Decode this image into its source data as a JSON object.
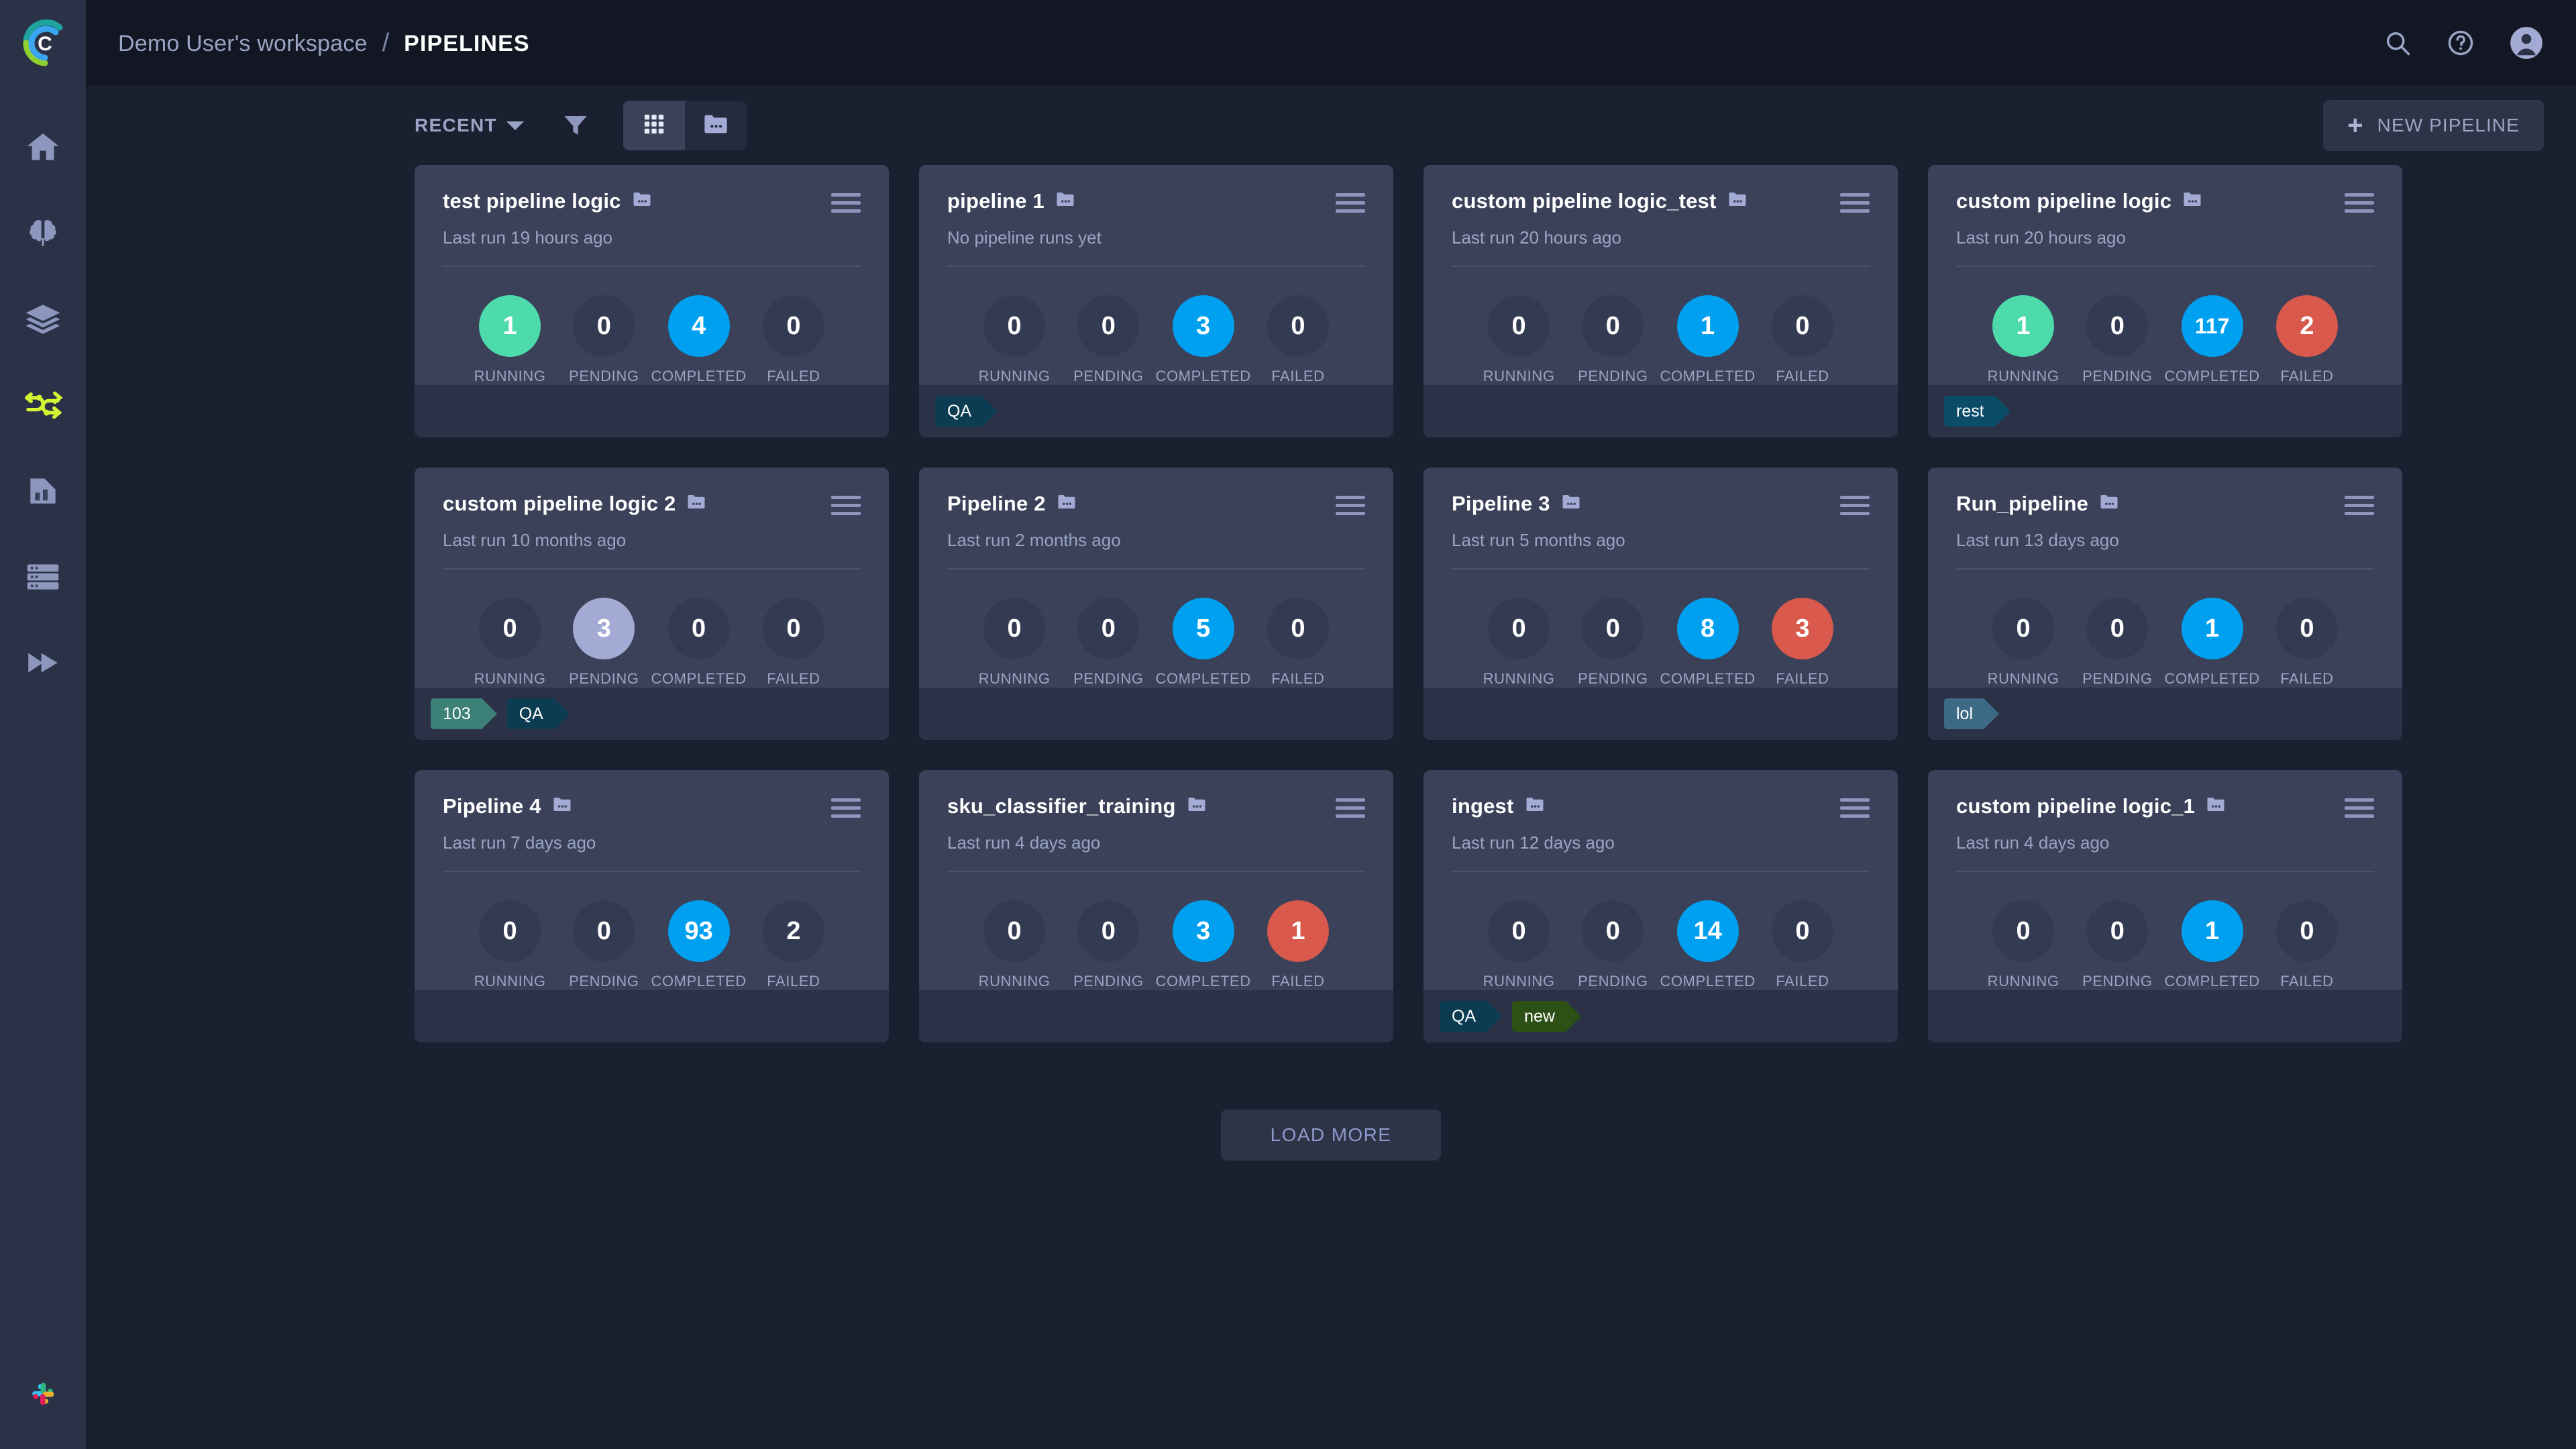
{
  "header": {
    "workspace": "Demo User's workspace",
    "separator": "/",
    "current": "PIPELINES",
    "search_icon": "search-icon",
    "help_icon": "help-circle-icon",
    "avatar_icon": "user-avatar-icon"
  },
  "sidebar": {
    "logo": "cnvrg-logo",
    "items": [
      {
        "name": "home",
        "icon": "home-icon",
        "active": false
      },
      {
        "name": "ai-library",
        "icon": "brain-icon",
        "active": false
      },
      {
        "name": "datasets",
        "icon": "layers-icon",
        "active": false
      },
      {
        "name": "pipelines",
        "icon": "pipeline-flow-icon",
        "active": true
      },
      {
        "name": "experiments",
        "icon": "report-chart-icon",
        "active": false
      },
      {
        "name": "compute",
        "icon": "server-rack-icon",
        "active": false
      },
      {
        "name": "deployments",
        "icon": "fast-forward-icon",
        "active": false
      }
    ],
    "bottom_item": {
      "name": "slack",
      "icon": "slack-icon"
    }
  },
  "toolbar": {
    "sort_label": "RECENT",
    "filter_icon": "funnel-filter-icon",
    "view_grid_icon": "grid-view-icon",
    "view_folder_icon": "folder-view-icon",
    "active_view": "grid",
    "new_pipeline_label": "NEW PIPELINE",
    "new_pipeline_icon": "plus-icon"
  },
  "stat_labels": {
    "running": "RUNNING",
    "pending": "PENDING",
    "completed": "COMPLETED",
    "failed": "FAILED"
  },
  "colors": {
    "running": "#4ddbac",
    "pending": "#a3aad4",
    "completed": "#00a0f0",
    "failed": "#d9594c",
    "inactive": "#333b52",
    "card_bg": "#3a4159",
    "card_footer_bg": "#2b3247",
    "page_bg": "#1a2030",
    "sidebar_bg": "#2b3247",
    "topbar_bg": "#131723",
    "accent_active_nav": "#d4f531"
  },
  "tag_colors": {
    "QA": "#0b3c52",
    "rest": "#0b4c66",
    "103": "#3d8078",
    "lol": "#3d6b85",
    "new": "#2d5016"
  },
  "cards": [
    {
      "title": "test pipeline logic",
      "subtitle": "Last run 19 hours ago",
      "stats": [
        {
          "key": "running",
          "value": "1",
          "state": "running"
        },
        {
          "key": "pending",
          "value": "0",
          "state": "inactive"
        },
        {
          "key": "completed",
          "value": "4",
          "state": "completed"
        },
        {
          "key": "failed",
          "value": "0",
          "state": "inactive"
        }
      ],
      "tags": []
    },
    {
      "title": "pipeline 1",
      "subtitle": "No pipeline runs yet",
      "stats": [
        {
          "key": "running",
          "value": "0",
          "state": "inactive"
        },
        {
          "key": "pending",
          "value": "0",
          "state": "inactive"
        },
        {
          "key": "completed",
          "value": "3",
          "state": "completed"
        },
        {
          "key": "failed",
          "value": "0",
          "state": "inactive"
        }
      ],
      "tags": [
        "QA"
      ]
    },
    {
      "title": "custom pipeline logic_test",
      "subtitle": "Last run 20 hours ago",
      "stats": [
        {
          "key": "running",
          "value": "0",
          "state": "inactive"
        },
        {
          "key": "pending",
          "value": "0",
          "state": "inactive"
        },
        {
          "key": "completed",
          "value": "1",
          "state": "completed"
        },
        {
          "key": "failed",
          "value": "0",
          "state": "inactive"
        }
      ],
      "tags": []
    },
    {
      "title": "custom pipeline logic",
      "subtitle": "Last run 20 hours ago",
      "stats": [
        {
          "key": "running",
          "value": "1",
          "state": "running"
        },
        {
          "key": "pending",
          "value": "0",
          "state": "inactive"
        },
        {
          "key": "completed",
          "value": "117",
          "state": "completed"
        },
        {
          "key": "failed",
          "value": "2",
          "state": "failed"
        }
      ],
      "tags": [
        "rest"
      ]
    },
    {
      "title": "custom pipeline logic 2",
      "subtitle": "Last run 10 months ago",
      "stats": [
        {
          "key": "running",
          "value": "0",
          "state": "inactive"
        },
        {
          "key": "pending",
          "value": "3",
          "state": "pending"
        },
        {
          "key": "completed",
          "value": "0",
          "state": "inactive"
        },
        {
          "key": "failed",
          "value": "0",
          "state": "inactive"
        }
      ],
      "tags": [
        "103",
        "QA"
      ]
    },
    {
      "title": "Pipeline 2",
      "subtitle": "Last run 2 months ago",
      "stats": [
        {
          "key": "running",
          "value": "0",
          "state": "inactive"
        },
        {
          "key": "pending",
          "value": "0",
          "state": "inactive"
        },
        {
          "key": "completed",
          "value": "5",
          "state": "completed"
        },
        {
          "key": "failed",
          "value": "0",
          "state": "inactive"
        }
      ],
      "tags": []
    },
    {
      "title": "Pipeline 3",
      "subtitle": "Last run 5 months ago",
      "stats": [
        {
          "key": "running",
          "value": "0",
          "state": "inactive"
        },
        {
          "key": "pending",
          "value": "0",
          "state": "inactive"
        },
        {
          "key": "completed",
          "value": "8",
          "state": "completed"
        },
        {
          "key": "failed",
          "value": "3",
          "state": "failed"
        }
      ],
      "tags": []
    },
    {
      "title": "Run_pipeline",
      "subtitle": "Last run 13 days ago",
      "stats": [
        {
          "key": "running",
          "value": "0",
          "state": "inactive"
        },
        {
          "key": "pending",
          "value": "0",
          "state": "inactive"
        },
        {
          "key": "completed",
          "value": "1",
          "state": "completed"
        },
        {
          "key": "failed",
          "value": "0",
          "state": "inactive"
        }
      ],
      "tags": [
        "lol"
      ]
    },
    {
      "title": "Pipeline 4",
      "subtitle": "Last run 7 days ago",
      "stats": [
        {
          "key": "running",
          "value": "0",
          "state": "inactive"
        },
        {
          "key": "pending",
          "value": "0",
          "state": "inactive"
        },
        {
          "key": "completed",
          "value": "93",
          "state": "completed"
        },
        {
          "key": "failed",
          "value": "2",
          "state": "inactive"
        }
      ],
      "tags": []
    },
    {
      "title": "sku_classifier_training",
      "subtitle": "Last run 4 days ago",
      "stats": [
        {
          "key": "running",
          "value": "0",
          "state": "inactive"
        },
        {
          "key": "pending",
          "value": "0",
          "state": "inactive"
        },
        {
          "key": "completed",
          "value": "3",
          "state": "completed"
        },
        {
          "key": "failed",
          "value": "1",
          "state": "failed"
        }
      ],
      "tags": []
    },
    {
      "title": "ingest",
      "subtitle": "Last run 12 days ago",
      "stats": [
        {
          "key": "running",
          "value": "0",
          "state": "inactive"
        },
        {
          "key": "pending",
          "value": "0",
          "state": "inactive"
        },
        {
          "key": "completed",
          "value": "14",
          "state": "completed"
        },
        {
          "key": "failed",
          "value": "0",
          "state": "inactive"
        }
      ],
      "tags": [
        "QA",
        "new"
      ]
    },
    {
      "title": "custom pipeline logic_1",
      "subtitle": "Last run 4 days ago",
      "stats": [
        {
          "key": "running",
          "value": "0",
          "state": "inactive"
        },
        {
          "key": "pending",
          "value": "0",
          "state": "inactive"
        },
        {
          "key": "completed",
          "value": "1",
          "state": "completed"
        },
        {
          "key": "failed",
          "value": "0",
          "state": "inactive"
        }
      ],
      "tags": []
    }
  ],
  "footer": {
    "load_more_label": "LOAD MORE"
  }
}
